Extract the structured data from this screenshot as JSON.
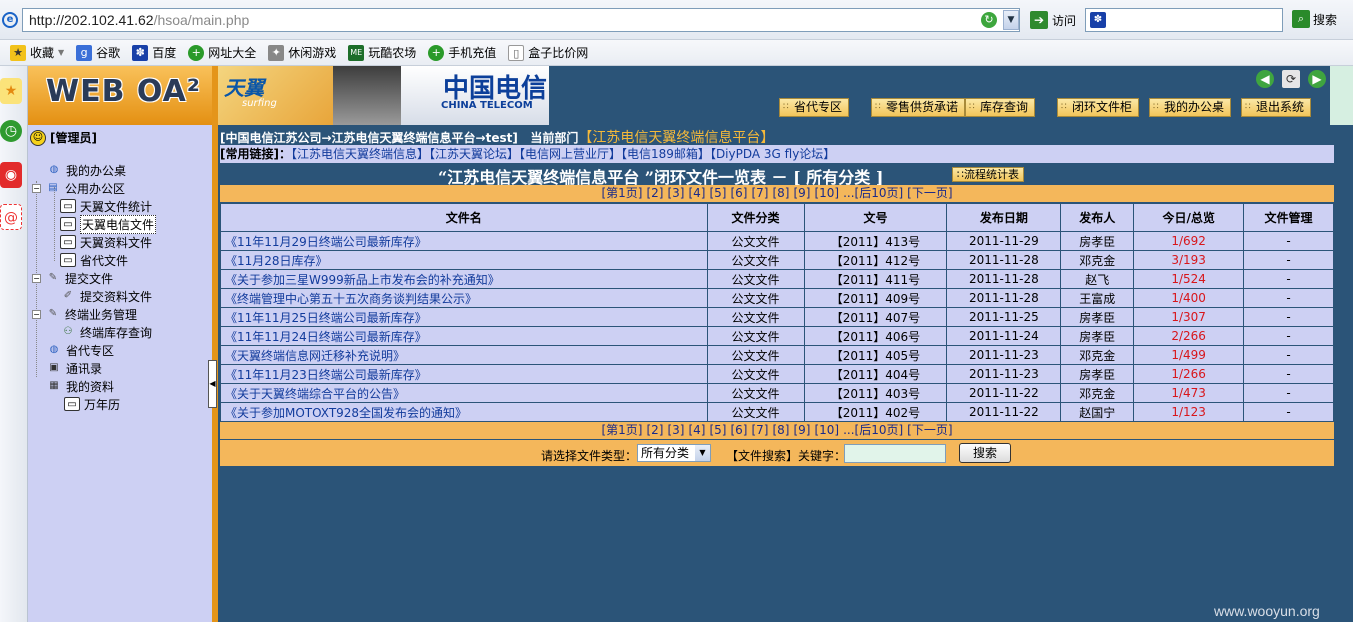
{
  "browser": {
    "url_host": "http://202.102.41.62",
    "url_path": "/hsoa/main.php",
    "visit_label": "访问",
    "search_label": "搜索",
    "favorites": [
      "收藏",
      "谷歌",
      "百度",
      "网址大全",
      "休闲游戏",
      "玩酷农场",
      "手机充值",
      "盒子比价网"
    ]
  },
  "logo": "WEB OA²",
  "user": "[管理员]",
  "tree": [
    "我的办公桌",
    "公用办公区",
    "天翼文件统计",
    "天翼电信文件",
    "天翼资料文件",
    "省代文件",
    "提交文件",
    "提交资料文件",
    "终端业务管理",
    "终端库存查询",
    "省代专区",
    "通讯录",
    "我的资料",
    "万年历"
  ],
  "banner": {
    "tianyi": "天翼",
    "surfing": "surfing",
    "ct_zh": "中国电信",
    "ct_en": "CHINA TELECOM",
    "nav": [
      "省代专区",
      "零售供货承诺",
      "库存查询",
      "闭环文件柜",
      "我的办公桌",
      "退出系统"
    ]
  },
  "crumb": {
    "path": "[中国电信江苏公司→江苏电信天翼终端信息平台→test]",
    "dept_label": "当前部门",
    "dept": "【江苏电信天翼终端信息平台】"
  },
  "links": {
    "label": "[常用链接]：",
    "items": [
      "【江苏电信天翼终端信息】",
      "【江苏天翼论坛】",
      "【电信网上营业厅】",
      "【电信189邮箱】",
      "【DiyPDA 3G fly论坛】"
    ]
  },
  "title": "“江苏电信天翼终端信息平台 ”闭环文件一览表 － [ 所有分类 ]",
  "stat_button": "流程统计表",
  "pager": [
    "[第1页]",
    "[2]",
    "[3]",
    "[4]",
    "[5]",
    "[6]",
    "[7]",
    "[8]",
    "[9]",
    "[10]",
    "...[后10页]",
    "[下一页]"
  ],
  "table": {
    "headers": [
      "文件名",
      "文件分类",
      "文号",
      "发布日期",
      "发布人",
      "今日/总览",
      "文件管理"
    ],
    "rows": [
      [
        "《11年11月29日终端公司最新库存》",
        "公文文件",
        "【2011】413号",
        "2011-11-29",
        "房孝臣",
        "1/692",
        "-"
      ],
      [
        "《11月28日库存》",
        "公文文件",
        "【2011】412号",
        "2011-11-28",
        "邓克金",
        "3/193",
        "-"
      ],
      [
        "《关于参加三星W999新品上市发布会的补充通知》",
        "公文文件",
        "【2011】411号",
        "2011-11-28",
        "赵飞",
        "1/524",
        "-"
      ],
      [
        "《终端管理中心第五十五次商务谈判结果公示》",
        "公文文件",
        "【2011】409号",
        "2011-11-28",
        "王富成",
        "1/400",
        "-"
      ],
      [
        "《11年11月25日终端公司最新库存》",
        "公文文件",
        "【2011】407号",
        "2011-11-25",
        "房孝臣",
        "1/307",
        "-"
      ],
      [
        "《11年11月24日终端公司最新库存》",
        "公文文件",
        "【2011】406号",
        "2011-11-24",
        "房孝臣",
        "2/266",
        "-"
      ],
      [
        "《天翼终端信息网迁移补充说明》",
        "公文文件",
        "【2011】405号",
        "2011-11-23",
        "邓克金",
        "1/499",
        "-"
      ],
      [
        "《11年11月23日终端公司最新库存》",
        "公文文件",
        "【2011】404号",
        "2011-11-23",
        "房孝臣",
        "1/266",
        "-"
      ],
      [
        "《关于天翼终端综合平台的公告》",
        "公文文件",
        "【2011】403号",
        "2011-11-22",
        "邓克金",
        "1/473",
        "-"
      ],
      [
        "《关于参加MOTOXT928全国发布会的通知》",
        "公文文件",
        "【2011】402号",
        "2011-11-22",
        "赵国宁",
        "1/123",
        "-"
      ]
    ]
  },
  "search": {
    "type_label": "请选择文件类型：",
    "type_value": "所有分类",
    "kw_label": "【文件搜索】关键字：",
    "button": "搜索"
  },
  "watermark": "www.wooyun.org"
}
